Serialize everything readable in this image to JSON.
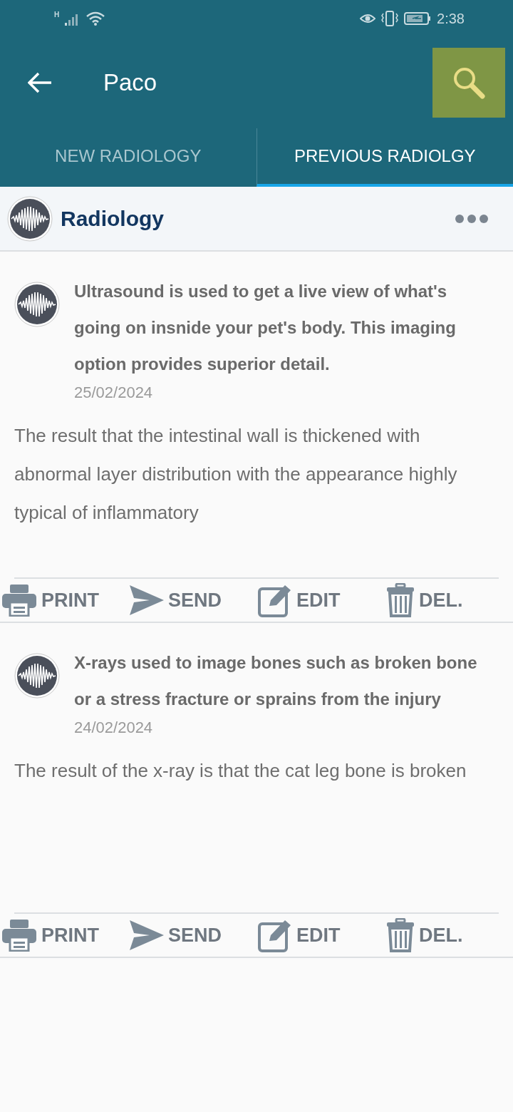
{
  "status_bar": {
    "network": "H",
    "time": "2:38"
  },
  "app_bar": {
    "title": "Paco"
  },
  "tabs": [
    {
      "label": "NEW RADIOLOGY",
      "selected": false
    },
    {
      "label": "PREVIOUS RADIOLGY",
      "selected": true
    }
  ],
  "section": {
    "title": "Radiology"
  },
  "records": [
    {
      "title": "Ultrasound is used to get a live view of what's going on insnide your pet's body. This imaging option provides superior detail.",
      "date": "25/02/2024",
      "result": "The result that the intestinal wall is thickened with abnormal layer distribution with the appearance highly typical of inflammatory",
      "actions": [
        {
          "kind": "print",
          "label": "PRINT"
        },
        {
          "kind": "send",
          "label": "SEND"
        },
        {
          "kind": "edit",
          "label": "EDIT"
        },
        {
          "kind": "delete",
          "label": "DEL."
        }
      ]
    },
    {
      "title": "X-rays used to image bones such as broken bone or a stress fracture or sprains from the injury",
      "date": "24/02/2024",
      "result": "The result of the x-ray is that the cat leg bone is broken",
      "actions": [
        {
          "kind": "print",
          "label": "PRINT"
        },
        {
          "kind": "send",
          "label": "SEND"
        },
        {
          "kind": "edit",
          "label": "EDIT"
        },
        {
          "kind": "delete",
          "label": "DEL."
        }
      ]
    }
  ]
}
